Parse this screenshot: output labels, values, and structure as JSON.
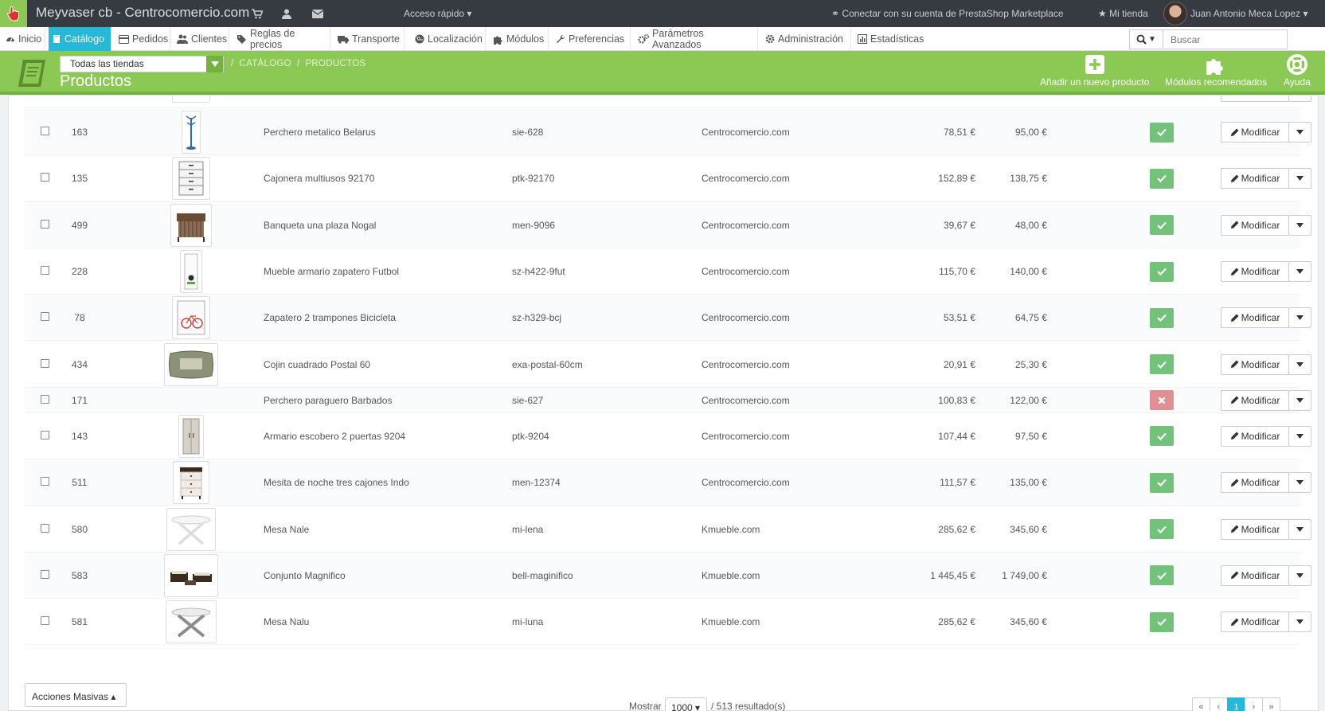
{
  "topbar": {
    "shop_name": "Meyvaser cb - Centrocomercio.com",
    "quick_access": "Acceso rápido",
    "connect_marketplace": "Conectar con su cuenta de PrestaShop Marketplace",
    "my_store": "Mi tienda",
    "user_name": "Juan Antonio Meca Lopez"
  },
  "menu": {
    "items": [
      {
        "label": "Inicio",
        "icon": "dashboard-icon"
      },
      {
        "label": "Catálogo",
        "icon": "book-icon"
      },
      {
        "label": "Pedidos",
        "icon": "credit-card-icon"
      },
      {
        "label": "Clientes",
        "icon": "users-icon"
      },
      {
        "label": "Reglas de precios",
        "icon": "tags-icon"
      },
      {
        "label": "Transporte",
        "icon": "truck-icon"
      },
      {
        "label": "Localización",
        "icon": "globe-icon"
      },
      {
        "label": "Módulos",
        "icon": "puzzle-icon"
      },
      {
        "label": "Preferencias",
        "icon": "wrench-icon"
      },
      {
        "label": "Parámetros Avanzados",
        "icon": "cogs-icon"
      },
      {
        "label": "Administración",
        "icon": "cog-icon"
      },
      {
        "label": "Estadísticas",
        "icon": "bar-chart-icon"
      }
    ],
    "active": "Catálogo"
  },
  "search": {
    "placeholder": "Buscar"
  },
  "header": {
    "shop_select": "Todas las tiendas",
    "breadcrumb": [
      "CATÁLOGO",
      "PRODUCTOS"
    ],
    "title": "Productos",
    "toolbar": {
      "add_product": "Añadir un nuevo producto",
      "recommended_modules": "Módulos recomendados",
      "help": "Ayuda"
    }
  },
  "products": [
    {
      "id": "163",
      "name": "Perchero metalico Belarus",
      "reference": "sie-628",
      "shop": "Centrocomercio.com",
      "price": "78,51 €",
      "final_price": "95,00 €",
      "active": true,
      "image": "coat-rack"
    },
    {
      "id": "135",
      "name": "Cajonera multiusos 92170",
      "reference": "ptk-92170",
      "shop": "Centrocomercio.com",
      "price": "152,89 €",
      "final_price": "138,75 €",
      "active": true,
      "image": "drawer-unit"
    },
    {
      "id": "499",
      "name": "Banqueta una plaza Nogal",
      "reference": "men-9096",
      "shop": "Centrocomercio.com",
      "price": "39,67 €",
      "final_price": "48,00 €",
      "active": true,
      "image": "bench"
    },
    {
      "id": "228",
      "name": "Mueble armario zapatero Futbol",
      "reference": "sz-h422-9fut",
      "shop": "Centrocomercio.com",
      "price": "115,70 €",
      "final_price": "140,00 €",
      "active": true,
      "image": "shoe-cabinet"
    },
    {
      "id": "78",
      "name": "Zapatero 2 trampones Bicicleta",
      "reference": "sz-h329-bcj",
      "shop": "Centrocomercio.com",
      "price": "53,51 €",
      "final_price": "64,75 €",
      "active": true,
      "image": "shoe-rack"
    },
    {
      "id": "434",
      "name": "Cojin cuadrado Postal 60",
      "reference": "exa-postal-60cm",
      "shop": "Centrocomercio.com",
      "price": "20,91 €",
      "final_price": "25,30 €",
      "active": true,
      "image": "cushion"
    },
    {
      "id": "171",
      "name": "Perchero paraguero Barbados",
      "reference": "sie-627",
      "shop": "Centrocomercio.com",
      "price": "100,83 €",
      "final_price": "122,00 €",
      "active": false,
      "image": ""
    },
    {
      "id": "143",
      "name": "Armario escobero 2 puertas 9204",
      "reference": "ptk-9204",
      "shop": "Centrocomercio.com",
      "price": "107,44 €",
      "final_price": "97,50 €",
      "active": true,
      "image": "wardrobe"
    },
    {
      "id": "511",
      "name": "Mesita de noche tres cajones Indo",
      "reference": "men-12374",
      "shop": "Centrocomercio.com",
      "price": "111,57 €",
      "final_price": "135,00 €",
      "active": true,
      "image": "nightstand"
    },
    {
      "id": "580",
      "name": "Mesa Nale",
      "reference": "mi-lena",
      "shop": "Kmueble.com",
      "price": "285,62 €",
      "final_price": "345,60 €",
      "active": true,
      "image": "table-white"
    },
    {
      "id": "583",
      "name": "Conjunto Magnifico",
      "reference": "bell-maginifico",
      "shop": "Kmueble.com",
      "price": "1 445,45 €",
      "final_price": "1 749,00 €",
      "active": true,
      "image": "sofa-set"
    },
    {
      "id": "581",
      "name": "Mesa Nalu",
      "reference": "mi-luna",
      "shop": "Kmueble.com",
      "price": "285,62 €",
      "final_price": "345,60 €",
      "active": true,
      "image": "table-grey"
    }
  ],
  "row_actions": {
    "edit_label": "Modificar"
  },
  "footer": {
    "bulk_actions": "Acciones Masivas",
    "show_label": "Mostrar",
    "per_page": "1000",
    "results": "/ 513 resultado(s)",
    "current_page": "1"
  },
  "colors": {
    "header_green": "#8bc954",
    "active_blue": "#25b9d7",
    "status_on": "#72c279",
    "status_off": "#e08f95",
    "topbar": "#363a41"
  }
}
